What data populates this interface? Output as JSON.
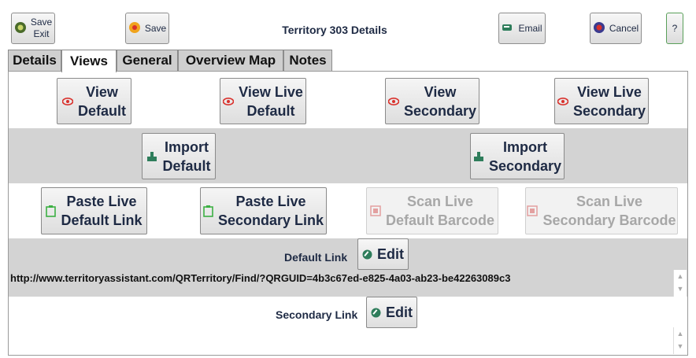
{
  "toolbar": {
    "save_exit_line1": "Save",
    "save_exit_line2": "Exit",
    "save": "Save",
    "title": "Territory 303 Details",
    "email": "Email",
    "cancel": "Cancel",
    "help": "?"
  },
  "tabs": [
    "Details",
    "Views",
    "General",
    "Overview Map",
    "Notes"
  ],
  "active_tab": "Views",
  "views": {
    "view_default": [
      "View",
      "Default"
    ],
    "view_live_default": [
      "View Live",
      "Default"
    ],
    "view_secondary": [
      "View",
      "Secondary"
    ],
    "view_live_secondary": [
      "View Live",
      "Secondary"
    ],
    "import_default": [
      "Import",
      "Default"
    ],
    "import_secondary": [
      "Import",
      "Secondary"
    ],
    "paste_live_default": [
      "Paste Live",
      "Default Link"
    ],
    "paste_live_secondary": [
      "Paste Live",
      "Secondary Link"
    ],
    "scan_live_default": [
      "Scan Live",
      "Default Barcode"
    ],
    "scan_live_secondary": [
      "Scan Live",
      "Secondary Barcode"
    ]
  },
  "default_link": {
    "label": "Default Link",
    "edit": "Edit",
    "url": "http://www.territoryassistant.com/QRTerritory/Find/?QRGUID=4b3c67ed-e825-4a03-ab23-be42263089c3"
  },
  "secondary_link": {
    "label": "Secondary Link",
    "edit": "Edit",
    "url": ""
  },
  "colors": {
    "text_navy": "#1e2a44",
    "band_gray": "#d3d3d3",
    "eye_red": "#d9302b",
    "paste_green": "#3cb043"
  }
}
